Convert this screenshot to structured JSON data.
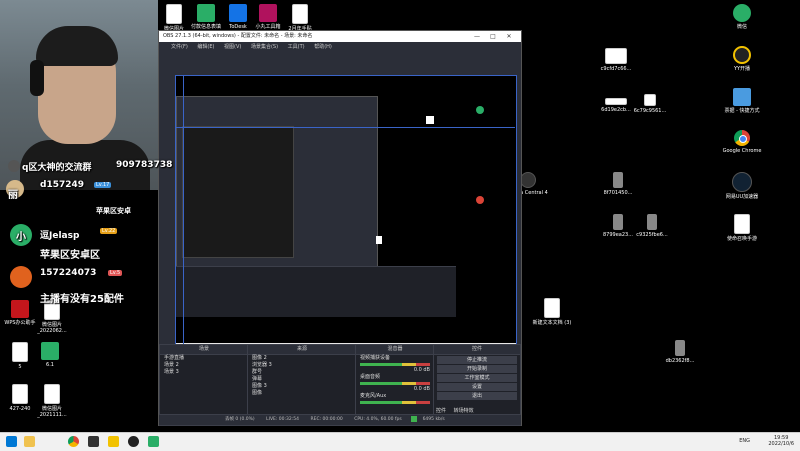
{
  "taskbar": {
    "time": "19:59",
    "date": "2022/10/6",
    "language": "ENG"
  },
  "desktop_icons": [
    {
      "label": "微信图片",
      "icon": "file-icon"
    },
    {
      "label": "付款信息表填",
      "icon": "excel-icon"
    },
    {
      "label": "ToDesk",
      "icon": "todesk-icon"
    },
    {
      "label": "小丸工具箱",
      "icon": "maru-icon"
    },
    {
      "label": "2月年手贴",
      "icon": "file-icon"
    },
    {
      "label": "微信",
      "icon": "wechat-icon"
    },
    {
      "label": "c9cfd7c66...",
      "icon": "image-icon"
    },
    {
      "label": "YY开播",
      "icon": "yy-icon"
    },
    {
      "label": "6d19e2cb...",
      "icon": "image-icon"
    },
    {
      "label": "6c79c9561...",
      "icon": "image-icon"
    },
    {
      "label": "票据 - 快捷方式",
      "icon": "shortcut-icon"
    },
    {
      "label": "Google Chrome",
      "icon": "chrome-icon"
    },
    {
      "label": "网易UU加速器",
      "icon": "uu-icon"
    },
    {
      "label": "8f701450...",
      "icon": "file-icon"
    },
    {
      "label": "8799ea23...",
      "icon": "file-icon"
    },
    {
      "label": "c9325fbe6...",
      "icon": "file-icon"
    },
    {
      "label": "使命召唤手游",
      "icon": "game-icon"
    },
    {
      "label": "新建文本文档 (3)",
      "icon": "text-file-icon"
    },
    {
      "label": "db2362f8...",
      "icon": "file-icon"
    },
    {
      "label": "WPS办公助手",
      "icon": "wps-icon"
    },
    {
      "label": "微信图片_2022062...",
      "icon": "file-icon"
    },
    {
      "label": "5",
      "icon": "file-icon"
    },
    {
      "label": "6.1",
      "icon": "excel-icon"
    },
    {
      "label": "427-240",
      "icon": "file-icon"
    },
    {
      "label": "微信图片_2021111...",
      "icon": "file-icon"
    },
    {
      "label": "Media Central 4",
      "icon": "media-central-icon"
    }
  ],
  "chat": {
    "line1": "q区大神的交流群",
    "line1_number": "909783738",
    "user1": "丽",
    "user1_id": "d157249",
    "user2": "苹果区安卓",
    "user3": "小",
    "user3_handle": "逗Jelasp",
    "line_apple": "苹果区安卓区",
    "user4_id": "157224073",
    "line_main": "主播有没有25配件",
    "level_badge1": "Lv.17",
    "level_badge2": "Lv.22",
    "level_badge3": "Lv.5"
  },
  "obs": {
    "title": "OBS 27.1.3 (64-bit, windows) - 配置文件: 未命名 - 场景: 未命名",
    "menu": [
      "文件(F)",
      "编辑(E)",
      "视图(V)",
      "场景集合(S)",
      "工具(T)",
      "帮助(H)"
    ],
    "docks": {
      "scenes": {
        "title": "场景",
        "items": [
          "手游直播",
          "场景 2",
          "场景 3"
        ]
      },
      "sources": {
        "title": "来源",
        "items": [
          "图像 2",
          "浏览器 3",
          "群号",
          "弹幕",
          "图像 3",
          "图像"
        ]
      },
      "mixer": {
        "title": "混音器",
        "tracks": [
          {
            "name": "视频捕获设备",
            "db": "0.0 dB"
          },
          {
            "name": "桌面音频",
            "db": "0.0 dB"
          },
          {
            "name": "麦克风/Aux",
            "db": "0.0 dB"
          }
        ]
      },
      "controls": {
        "title": "控件",
        "buttons": [
          "停止推流",
          "开始录制",
          "工作室模式",
          "设置",
          "退出"
        ]
      }
    },
    "tabs": [
      "控件",
      "转场特效"
    ],
    "status": {
      "dropped": "丢帧 0 (0.0%)",
      "live": "LIVE: 00:32:54",
      "rec": "REC: 00:00:00",
      "cpu": "CPU: 4.0%, 60.00 fps",
      "bitrate": "6495 kb/s"
    }
  }
}
